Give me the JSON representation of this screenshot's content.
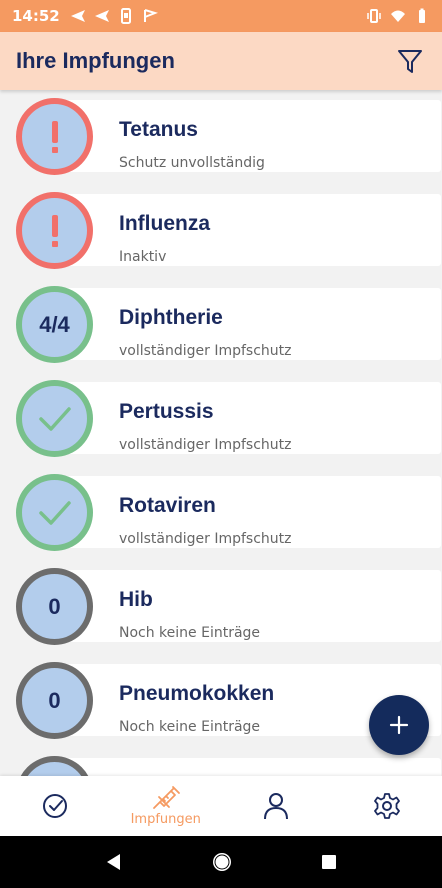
{
  "status_bar": {
    "time": "14:52"
  },
  "header": {
    "title": "Ihre Impfungen"
  },
  "vaccines": [
    {
      "name": "Tetanus",
      "status": "Schutz unvollständig",
      "badge": "!",
      "state": "red"
    },
    {
      "name": "Influenza",
      "status": "Inaktiv",
      "badge": "!",
      "state": "red"
    },
    {
      "name": "Diphtherie",
      "status": "vollständiger Impfschutz",
      "badge": "4/4",
      "state": "green"
    },
    {
      "name": "Pertussis",
      "status": "vollständiger Impfschutz",
      "badge": "check",
      "state": "green"
    },
    {
      "name": "Rotaviren",
      "status": "vollständiger Impfschutz",
      "badge": "check",
      "state": "green"
    },
    {
      "name": "Hib",
      "status": "Noch keine Einträge",
      "badge": "0",
      "state": "gray"
    },
    {
      "name": "Pneumokokken",
      "status": "Noch keine Einträge",
      "badge": "0",
      "state": "gray"
    }
  ],
  "bottom_nav": {
    "items": [
      {
        "label": "",
        "icon": "check-circle-icon"
      },
      {
        "label": "Impfungen",
        "icon": "syringe-icon"
      },
      {
        "label": "",
        "icon": "person-icon"
      },
      {
        "label": "",
        "icon": "gear-icon"
      }
    ]
  },
  "colors": {
    "accent": "#f59a61",
    "header_bg": "#fcd9c4",
    "navy": "#1b2a5e",
    "red": "#f1706a",
    "green": "#78c08b",
    "gray": "#6c6c6c",
    "badge_fill": "#b3cdec"
  }
}
